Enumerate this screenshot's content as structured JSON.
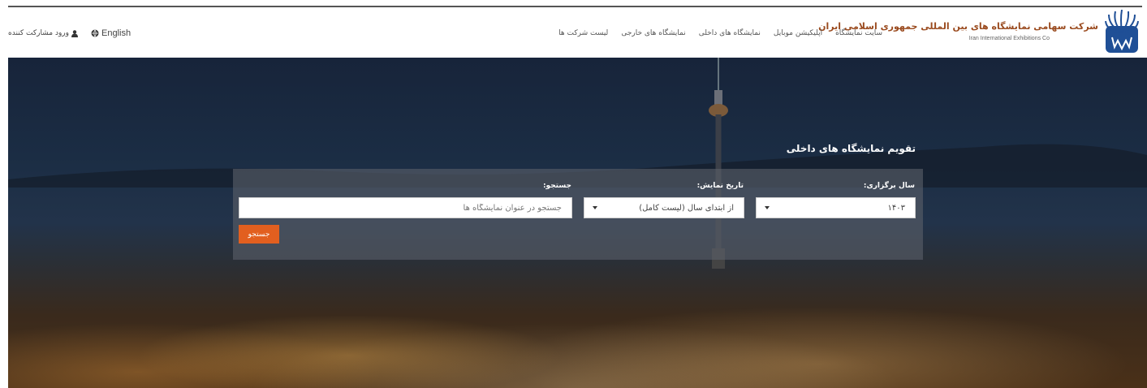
{
  "header": {
    "brand_name": "شرکت سهامی نمایشگاه های بین المللی جمهوری اسلامی ایران",
    "brand_subtitle": "Iran International Exhibitions Co",
    "menu": [
      {
        "label": "سایت نمایشگاه"
      },
      {
        "label": "اپلیکیشن موبایل"
      },
      {
        "label": "نمایشگاه های داخلی"
      },
      {
        "label": "نمایشگاه های خارجی"
      },
      {
        "label": "لیست شرکت ها"
      }
    ],
    "language_link": "English",
    "login_link": "ورود مشارکت کننده"
  },
  "hero": {
    "title": "تقویم نمایشگاه های داخلی"
  },
  "search": {
    "year_label": "سال برگزاری:",
    "year_value": "۱۴۰۳",
    "date_label": "تاریخ نمایش:",
    "date_value": "از ابتدای سال (لیست کامل)",
    "query_label": "جستجو:",
    "query_placeholder": "جستجو در عنوان نمایشگاه ها",
    "query_value": "",
    "button_label": "جستجو"
  },
  "colors": {
    "brand": "#9a4a1e",
    "button": "#e25f1f"
  },
  "icons": {
    "language": "globe-icon",
    "login": "user-icon",
    "logo": "iran-exhibitions-logo"
  }
}
